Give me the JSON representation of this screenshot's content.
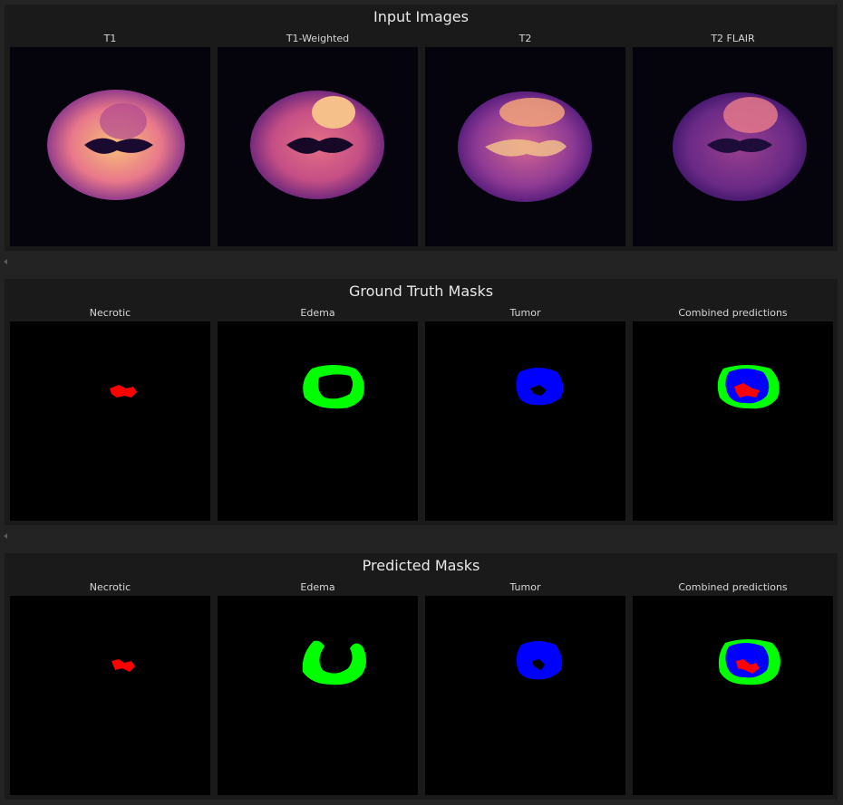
{
  "sections": [
    {
      "title": "Input Images",
      "images": [
        {
          "title": "T1",
          "kind": "mri-t1"
        },
        {
          "title": "T1-Weighted",
          "kind": "mri-t1w"
        },
        {
          "title": "T2",
          "kind": "mri-t2"
        },
        {
          "title": "T2 FLAIR",
          "kind": "mri-flair"
        }
      ]
    },
    {
      "title": "Ground Truth Masks",
      "images": [
        {
          "title": "Necrotic",
          "kind": "mask-necrotic"
        },
        {
          "title": "Edema",
          "kind": "mask-edema"
        },
        {
          "title": "Tumor",
          "kind": "mask-tumor"
        },
        {
          "title": "Combined predictions",
          "kind": "mask-combined"
        }
      ]
    },
    {
      "title": "Predicted Masks",
      "images": [
        {
          "title": "Necrotic",
          "kind": "mask-necrotic"
        },
        {
          "title": "Edema",
          "kind": "mask-edema"
        },
        {
          "title": "Tumor",
          "kind": "mask-tumor"
        },
        {
          "title": "Combined predictions",
          "kind": "mask-combined"
        }
      ]
    }
  ],
  "colors": {
    "necrotic": "#ff0000",
    "edema": "#00ff00",
    "tumor": "#0000ff",
    "panel_bg": "#1a1a1a",
    "page_bg": "#232323"
  }
}
